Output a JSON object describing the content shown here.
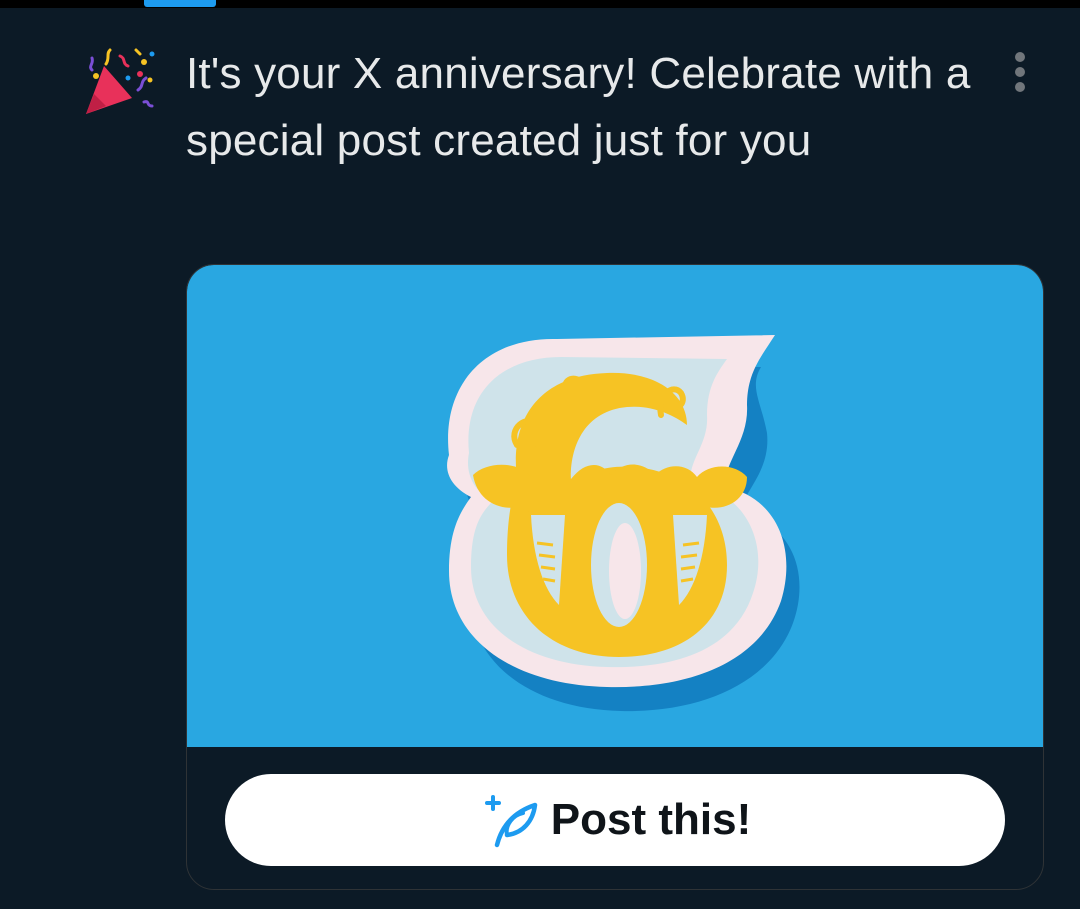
{
  "notification": {
    "icon": "party-popper-icon",
    "headline": "It's your X anniversary! Celebrate with a special post created just for you",
    "more_icon": "more-vertical-icon"
  },
  "card": {
    "image_subject": "six-anniversary-papercraft-image",
    "button_label": "Post this!",
    "button_icon": "compose-feather-plus-icon"
  },
  "colors": {
    "background": "#0c1a26",
    "card_sky": "#29a7e1",
    "numeral_yellow": "#f6c324",
    "accent_blue": "#1d9bf0",
    "button_bg": "#ffffff"
  }
}
